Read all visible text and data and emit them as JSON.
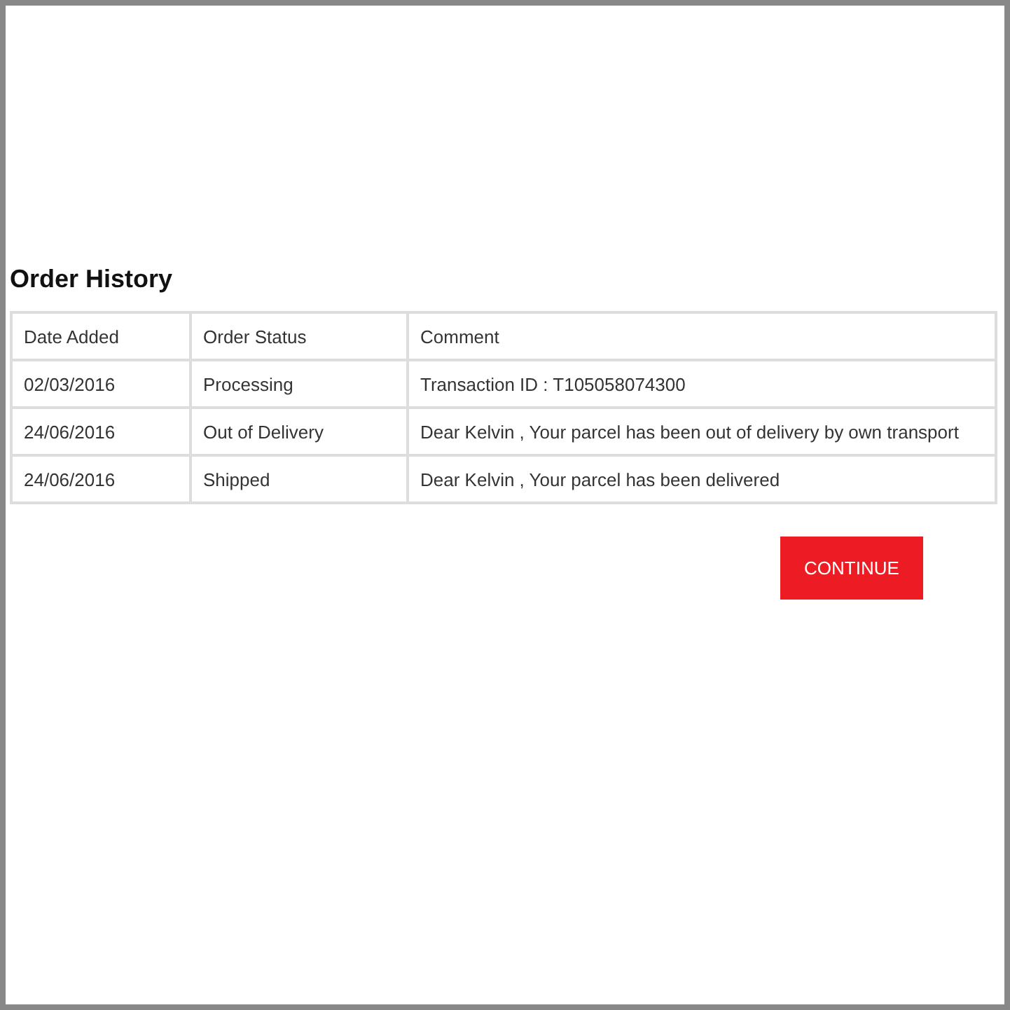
{
  "heading": "Order History",
  "table": {
    "columns": [
      "Date Added",
      "Order Status",
      "Comment"
    ],
    "rows": [
      [
        "02/03/2016",
        "Processing",
        "Transaction ID : T105058074300"
      ],
      [
        "24/06/2016",
        "Out of Delivery",
        "Dear Kelvin , Your parcel has been out of delivery by own transport"
      ],
      [
        "24/06/2016",
        "Shipped",
        "Dear Kelvin , Your parcel has been delivered"
      ]
    ]
  },
  "button": "CONTINUE"
}
